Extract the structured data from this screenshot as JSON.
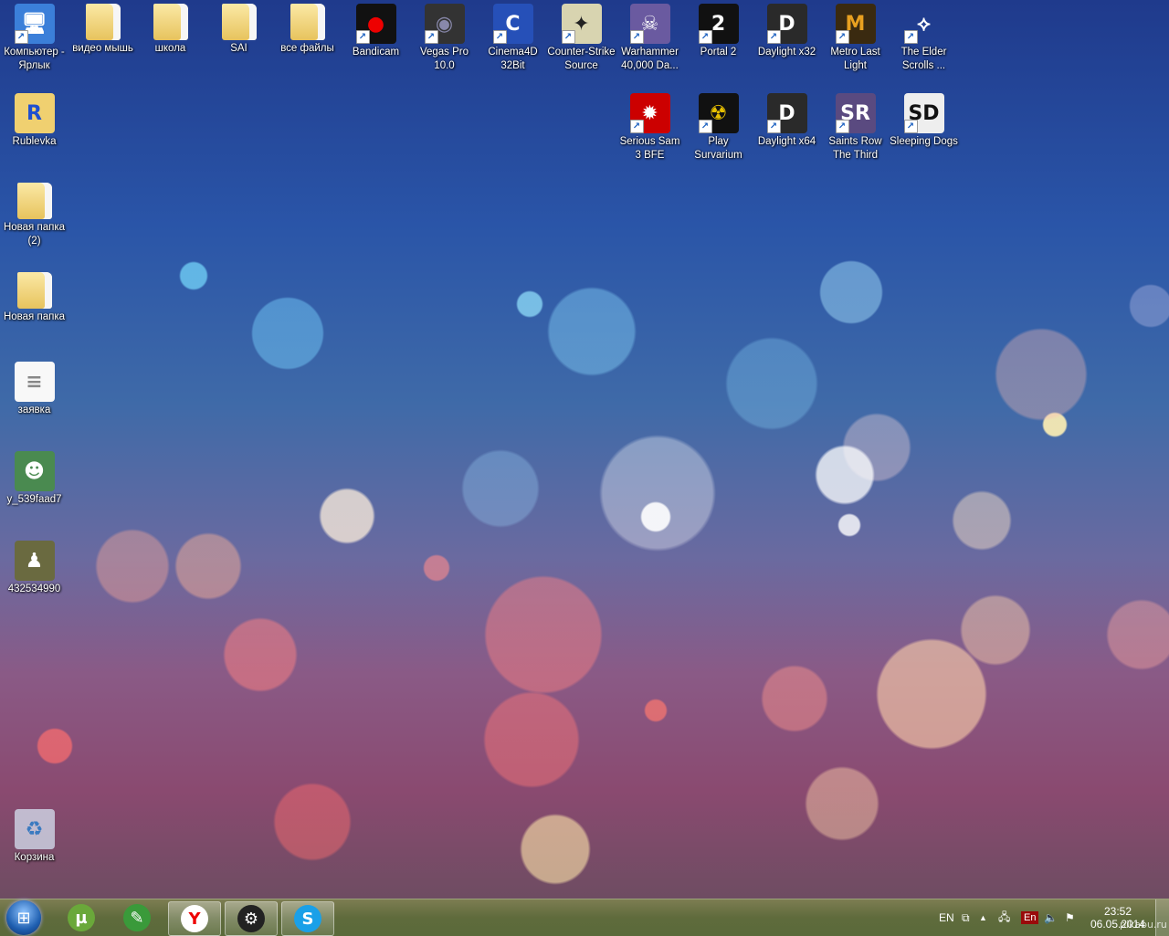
{
  "desktop": {
    "icons": [
      {
        "label": "Компьютер - Ярлык",
        "icon": "computer-icon",
        "glyph": "🖥",
        "color": "#3b7fd9",
        "shortcut": true
      },
      {
        "label": "видео мышь",
        "icon": "folder-icon",
        "folder": true
      },
      {
        "label": "школа",
        "icon": "folder-icon",
        "folder": true
      },
      {
        "label": "SAI",
        "icon": "folder-icon",
        "folder": true
      },
      {
        "label": "все файлы",
        "icon": "folder-icon",
        "folder": true
      },
      {
        "label": "Bandicam",
        "icon": "bandicam-icon",
        "glyph": "●",
        "color": "#111",
        "fg": "#e00",
        "shortcut": true
      },
      {
        "label": "Vegas Pro 10.0",
        "icon": "vegas-pro-icon",
        "glyph": "◉",
        "color": "#333",
        "fg": "#88a",
        "shortcut": true
      },
      {
        "label": "Cinema4D 32Bit",
        "icon": "cinema4d-icon",
        "glyph": "C",
        "color": "#2650b8",
        "shortcut": true
      },
      {
        "label": "Counter-Strike Source",
        "icon": "counter-strike-icon",
        "glyph": "✦",
        "color": "#d8d4b0",
        "fg": "#222",
        "shortcut": true
      },
      {
        "label": "Warhammer 40,000 Da...",
        "icon": "warhammer-icon",
        "glyph": "☠",
        "color": "#6a5aa0",
        "shortcut": true
      },
      {
        "label": "Portal 2",
        "icon": "portal2-icon",
        "glyph": "2",
        "color": "#111",
        "fg": "#fff",
        "shortcut": true
      },
      {
        "label": "Daylight x32",
        "icon": "daylight-icon",
        "glyph": "D",
        "color": "#2a2a2a",
        "shortcut": true
      },
      {
        "label": "Metro Last Light",
        "icon": "metro-icon",
        "glyph": "M",
        "color": "#3a2a10",
        "fg": "#e8a020",
        "shortcut": true
      },
      {
        "label": "The Elder Scrolls ...",
        "icon": "skyrim-icon",
        "glyph": "⟡",
        "color": "transparent",
        "fg": "#fff",
        "shortcut": true
      },
      {
        "label": "Serious Sam 3 BFE",
        "icon": "serious-sam-icon",
        "glyph": "✹",
        "color": "#c00",
        "shortcut": true
      },
      {
        "label": "Play Survarium",
        "icon": "survarium-icon",
        "glyph": "☢",
        "color": "#111",
        "fg": "#e8c000",
        "shortcut": true
      },
      {
        "label": "Daylight x64",
        "icon": "daylight-icon",
        "glyph": "D",
        "color": "#2a2a2a",
        "shortcut": true
      },
      {
        "label": "Saints Row The Third",
        "icon": "saints-row-icon",
        "glyph": "SR",
        "color": "#5a4a80",
        "shortcut": true
      },
      {
        "label": "Sleeping Dogs",
        "icon": "sleeping-dogs-icon",
        "glyph": "SD",
        "color": "#eee",
        "fg": "#111",
        "shortcut": true
      },
      {
        "label": "Rublevka",
        "icon": "folder-r-icon",
        "glyph": "R",
        "color": "#f0d070",
        "fg": "#1f4fd0"
      },
      {
        "label": "Новая папка (2)",
        "icon": "folder-icon",
        "folder": true
      },
      {
        "label": "Новая папка",
        "icon": "folder-icon",
        "folder": true
      },
      {
        "label": "заявка",
        "icon": "text-file-icon",
        "glyph": "≡",
        "color": "#f8f8f8",
        "fg": "#888"
      },
      {
        "label": "y_539faad7",
        "icon": "image-file-icon",
        "glyph": "☻",
        "color": "#4a8a50"
      },
      {
        "label": "432534990",
        "icon": "image-file-icon",
        "glyph": "♟",
        "color": "#6a6a40"
      },
      {
        "label": "Корзина",
        "icon": "recycle-bin-icon",
        "glyph": "♻",
        "color": "rgba(220,235,250,0.7)",
        "fg": "#3a7ac0"
      }
    ]
  },
  "taskbar": {
    "apps": [
      {
        "name": "utorrent",
        "glyph": "µ",
        "color": "#6aa83a",
        "open": false
      },
      {
        "name": "paint-tool",
        "glyph": "✎",
        "color": "#3a9a3a",
        "open": false
      },
      {
        "name": "yandex-browser",
        "glyph": "Y",
        "color": "#fff",
        "fg": "#e00",
        "open": true
      },
      {
        "name": "steam",
        "glyph": "⚙",
        "color": "#222",
        "open": true
      },
      {
        "name": "skype",
        "glyph": "S",
        "color": "#1aa0e8",
        "open": true
      }
    ],
    "tray": {
      "language": "EN",
      "keyboard_indicator": "En",
      "time": "23:52",
      "date": "06.05.2014"
    }
  },
  "watermark": "pikabu.ru"
}
